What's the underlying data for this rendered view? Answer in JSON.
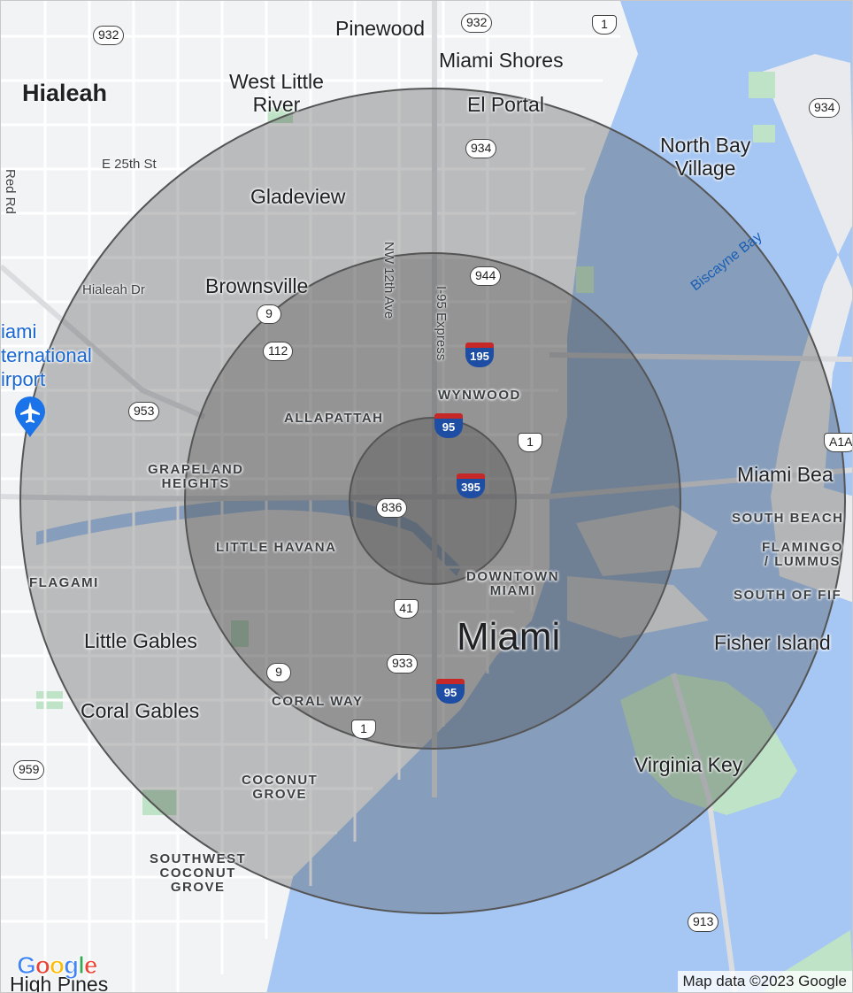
{
  "map": {
    "cities": {
      "hialeah": "Hialeah",
      "west_little_river": "West Little\nRiver",
      "pinewood": "Pinewood",
      "miami_shores": "Miami Shores",
      "el_portal": "El Portal",
      "north_bay_village": "North Bay\nVillage",
      "gladeview": "Gladeview",
      "brownsville": "Brownsville",
      "miami": "Miami",
      "miami_beach": "Miami Bea",
      "fisher_island": "Fisher Island",
      "little_gables": "Little Gables",
      "coral_gables": "Coral Gables",
      "virginia_key": "Virginia Key",
      "high_pines": "High Pines"
    },
    "neighborhoods": {
      "wynwood": "WYNWOOD",
      "allapattah": "ALLAPATTAH",
      "grapeland_heights": "GRAPELAND\nHEIGHTS",
      "little_havana": "LITTLE HAVANA",
      "flagami": "FLAGAMI",
      "downtown_miami": "DOWNTOWN\nMIAMI",
      "coral_way": "CORAL WAY",
      "coconut_grove": "COCONUT\nGROVE",
      "southwest_coconut_grove": "SOUTHWEST\nCOCONUT\nGROVE",
      "south_beach": "SOUTH BEACH",
      "flamingo_lummus": "FLAMINGO\n/ LUMMUS",
      "south_of_fifth": "SOUTH OF FIF"
    },
    "streets": {
      "e_25th_st": "E 25th St",
      "red_rd": "Red Rd",
      "hialeah_dr": "Hialeah Dr",
      "nw_12th_ave": "NW 12th Ave",
      "i95_express": "I-95 Express"
    },
    "water": {
      "biscayne_bay": "Biscayne Bay"
    },
    "airport": {
      "label": "iami\nternational\nirport",
      "icon": "airplane-icon"
    },
    "shields": {
      "s932a": "932",
      "s932b": "932",
      "s1a": "1",
      "s934a": "934",
      "s934b": "934",
      "s944": "944",
      "s9a": "9",
      "s112": "112",
      "s953": "953",
      "s1b": "1",
      "s836": "836",
      "s41": "41",
      "s933": "933",
      "s9b": "9",
      "s1c": "1",
      "s959": "959",
      "s913": "913",
      "sA1A": "A1A"
    },
    "interstates": {
      "i195": "195",
      "i95a": "95",
      "i395": "395",
      "i95b": "95"
    },
    "radius_rings": {
      "count": 3,
      "color": "#3c3c3c"
    },
    "logo": "Google",
    "attribution": "Map data ©2023 Google"
  }
}
